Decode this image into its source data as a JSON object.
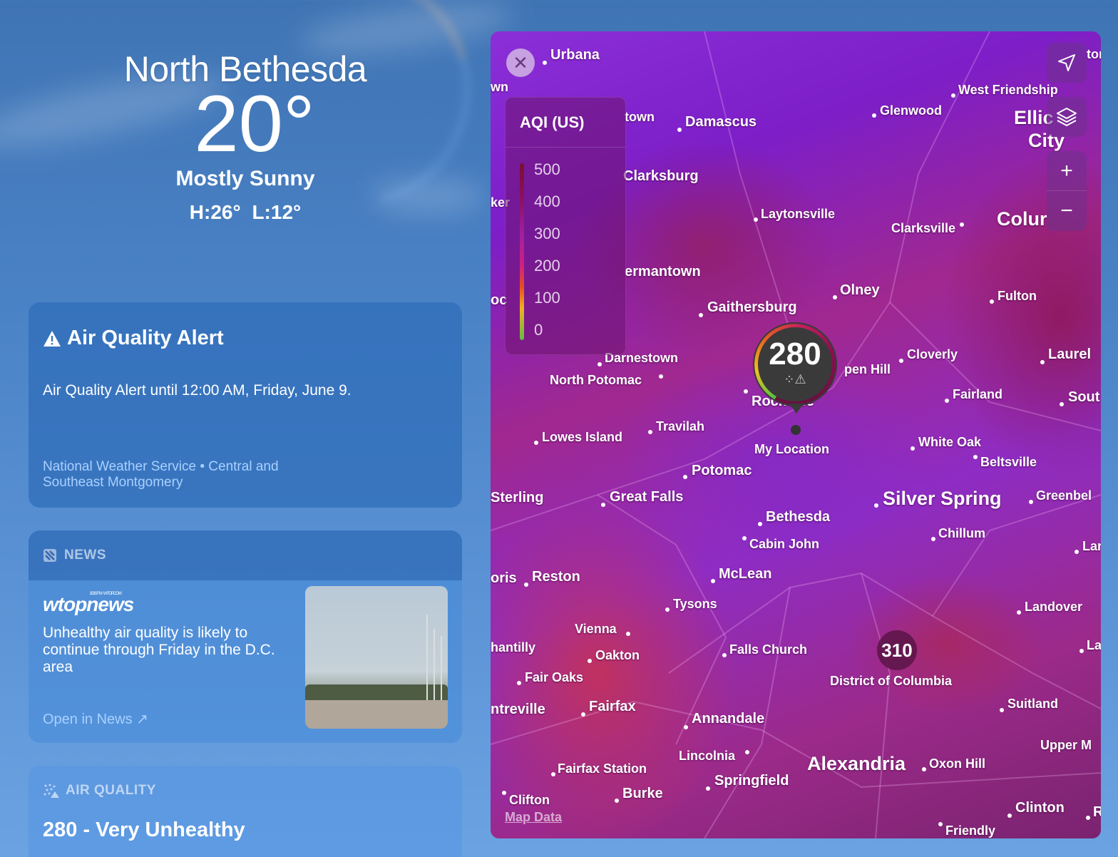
{
  "weather": {
    "location": "North Bethesda",
    "temperature": "20°",
    "condition": "Mostly Sunny",
    "high_low": "H:26°  L:12°"
  },
  "alert": {
    "title": "Air Quality Alert",
    "text": "Air Quality Alert until 12:00 AM, Friday, June 9.",
    "source": "National Weather Service • Central and Southeast Montgomery"
  },
  "news": {
    "header": "NEWS",
    "publisher": "wtopnews",
    "publisher_tag": "103.5 FM · WTOP.COM",
    "headline": "Unhealthy air quality is likely to continue through Friday in the D.C. area",
    "open_link": "Open in News ↗"
  },
  "air_quality": {
    "header": "AIR QUALITY",
    "value": "280 - Very Unhealthy"
  },
  "map": {
    "legend_title": "AQI (US)",
    "legend_ticks": [
      "500",
      "400",
      "300",
      "200",
      "100",
      "0"
    ],
    "pin_value": "280",
    "my_location": "My Location",
    "badge_value": "310",
    "map_data_link": "Map Data",
    "places": {
      "urbana": "Urbana",
      "west_friendship": "West Friendship",
      "ellicott": "Ellic",
      "ellicott_city": "City",
      "damascus": "Damascus",
      "glenwood": "Glenwood",
      "town": "town",
      "clarksburg": "Clarksburg",
      "laytonsville": "Laytonsville",
      "clarksville": "Clarksville",
      "columbia": "Colur",
      "germantown": "ermantown",
      "olney": "Olney",
      "fulton": "Fulton",
      "gaithersburg": "Gaithersburg",
      "darnestown": "Darnestown",
      "north_potomac": "North Potomac",
      "aspen_hill": "pen Hill",
      "cloverly": "Cloverly",
      "laurel": "Laurel",
      "rockville": "Rockville",
      "fairland": "Fairland",
      "south": "Sout",
      "lowes_island": "Lowes Island",
      "travilah": "Travilah",
      "white_oak": "White Oak",
      "beltsville": "Beltsville",
      "potomac": "Potomac",
      "sterling": "Sterling",
      "great_falls": "Great Falls",
      "silver_spring": "Silver Spring",
      "greenbelt": "Greenbel",
      "bethesda": "Bethesda",
      "chillum": "Chillum",
      "cabin_john": "Cabin John",
      "lan": "Lar",
      "loris": "oris",
      "reston": "Reston",
      "mclean": "McLean",
      "tysons": "Tysons",
      "landover": "Landover",
      "vienna": "Vienna",
      "chantilly": "hantilly",
      "oakton": "Oakton",
      "falls_church": "Falls Church",
      "la": "La",
      "fair_oaks": "Fair Oaks",
      "district": "District of Columbia",
      "centreville": "ntreville",
      "fairfax": "Fairfax",
      "annandale": "Annandale",
      "suitland": "Suitland",
      "lincolnia": "Lincolnia",
      "alexandria": "Alexandria",
      "oxon_hill": "Oxon Hill",
      "upper_m": "Upper M",
      "fairfax_station": "Fairfax Station",
      "springfield": "Springfield",
      "clifton": "Clifton",
      "burke": "Burke",
      "clinton": "Clinton",
      "friendly": "Friendly",
      "r": "R",
      "wn": "wn",
      "ker": "ker",
      "oo": "oc",
      "ton": "tor"
    }
  }
}
